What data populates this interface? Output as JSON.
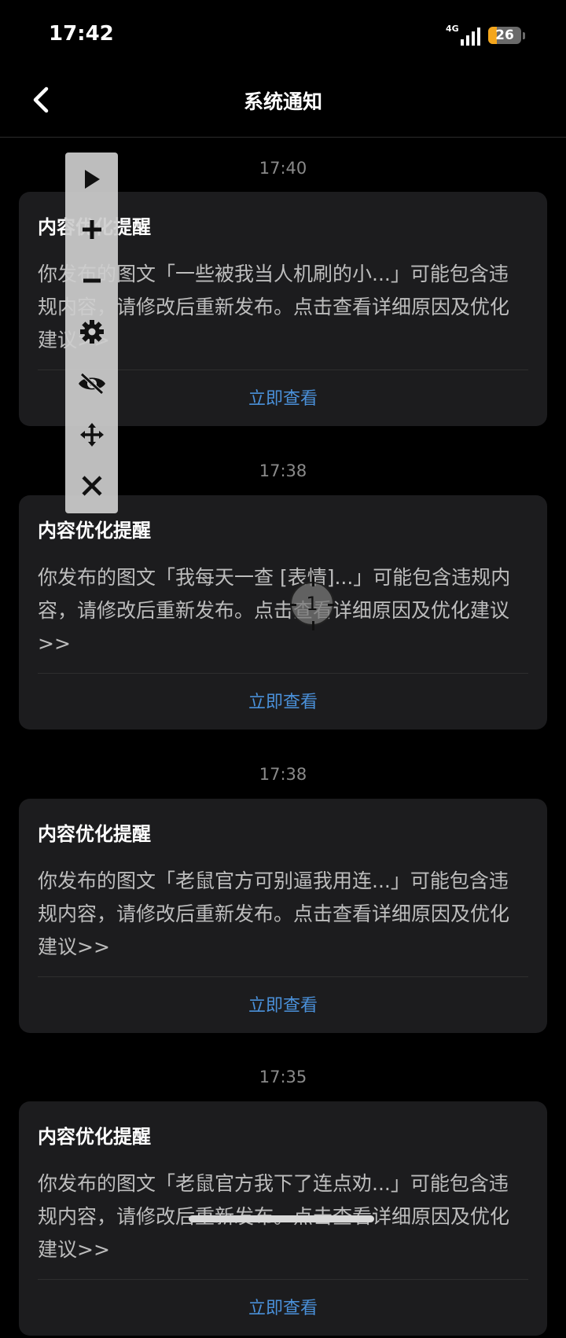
{
  "status_bar": {
    "time": "17:42",
    "network": "4G",
    "battery": "26",
    "battery_level": 0.26
  },
  "header": {
    "title": "系统通知"
  },
  "notifications": [
    {
      "time": "17:40",
      "title": "内容优化提醒",
      "body": "你发布的图文「一些被我当人机刷的小...」可能包含违规内容，请修改后重新发布。点击查看详细原因及优化建议>>",
      "action": "立即查看"
    },
    {
      "time": "17:38",
      "title": "内容优化提醒",
      "body": "你发布的图文「我每天一查 [表情]...」可能包含违规内容，请修改后重新发布。点击查看详细原因及优化建议>>",
      "action": "立即查看"
    },
    {
      "time": "17:38",
      "title": "内容优化提醒",
      "body": "你发布的图文「老鼠官方可别逼我用连...」可能包含违规内容，请修改后重新发布。点击查看详细原因及优化建议>>",
      "action": "立即查看"
    },
    {
      "time": "17:35",
      "title": "内容优化提醒",
      "body": "你发布的图文「老鼠官方我下了连点劝...」可能包含违规内容，请修改后重新发布。点击查看详细原因及优化建议>>",
      "action": "立即查看"
    }
  ],
  "overlay": {
    "tools": [
      "play-icon",
      "plus-icon",
      "minus-icon",
      "gear-icon",
      "eye-off-icon",
      "move-icon",
      "close-icon"
    ],
    "cursor_label": "1"
  }
}
